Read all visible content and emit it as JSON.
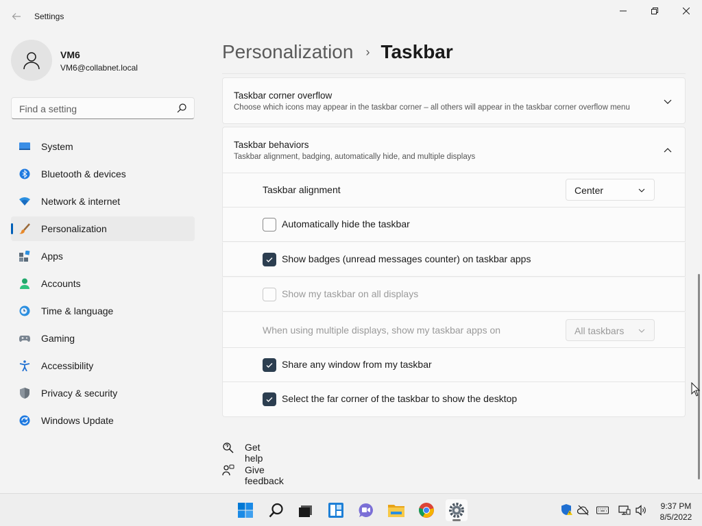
{
  "window": {
    "title": "Settings",
    "back_icon": "back-arrow-icon",
    "controls": [
      "minimize-icon",
      "maximize-icon",
      "close-icon"
    ]
  },
  "profile": {
    "name": "VM6",
    "email": "VM6@collabnet.local"
  },
  "search": {
    "placeholder": "Find a setting"
  },
  "sidebar": {
    "items": [
      {
        "label": "System",
        "icon": "system-icon",
        "selected": false
      },
      {
        "label": "Bluetooth & devices",
        "icon": "bluetooth-icon",
        "selected": false
      },
      {
        "label": "Network & internet",
        "icon": "network-icon",
        "selected": false
      },
      {
        "label": "Personalization",
        "icon": "personalization-brush-icon",
        "selected": true
      },
      {
        "label": "Apps",
        "icon": "apps-icon",
        "selected": false
      },
      {
        "label": "Accounts",
        "icon": "accounts-icon",
        "selected": false
      },
      {
        "label": "Time & language",
        "icon": "time-language-icon",
        "selected": false
      },
      {
        "label": "Gaming",
        "icon": "gaming-icon",
        "selected": false
      },
      {
        "label": "Accessibility",
        "icon": "accessibility-icon",
        "selected": false
      },
      {
        "label": "Privacy & security",
        "icon": "privacy-shield-icon",
        "selected": false
      },
      {
        "label": "Windows Update",
        "icon": "windows-update-icon",
        "selected": false
      }
    ]
  },
  "breadcrumb": {
    "parent": "Personalization",
    "separator": "›",
    "current": "Taskbar"
  },
  "main": {
    "corner_overflow": {
      "title": "Taskbar corner overflow",
      "description": "Choose which icons may appear in the taskbar corner – all others will appear in the taskbar corner overflow menu",
      "expanded": false
    },
    "behaviors": {
      "title": "Taskbar behaviors",
      "description": "Taskbar alignment, badging, automatically hide, and multiple displays",
      "expanded": true,
      "alignment": {
        "label": "Taskbar alignment",
        "value": "Center"
      },
      "options": [
        {
          "label": "Automatically hide the taskbar",
          "checked": false,
          "disabled": false
        },
        {
          "label": "Show badges (unread messages counter) on taskbar apps",
          "checked": true,
          "disabled": false
        },
        {
          "label": "Show my taskbar on all displays",
          "checked": false,
          "disabled": true
        }
      ],
      "multi_display": {
        "label": "When using multiple displays, show my taskbar apps on",
        "value": "All taskbars",
        "disabled": true
      },
      "more_options": [
        {
          "label": "Share any window from my taskbar",
          "checked": true,
          "disabled": false
        },
        {
          "label": "Select the far corner of the taskbar to show the desktop",
          "checked": true,
          "disabled": false
        }
      ]
    },
    "help": {
      "get_help": "Get help",
      "give_feedback": "Give feedback"
    }
  },
  "taskbar": {
    "apps": [
      "start-icon",
      "search-icon",
      "task-view-icon",
      "widgets-icon",
      "chat-icon",
      "file-explorer-icon",
      "chrome-icon",
      "settings-icon"
    ],
    "active_app": "settings-icon",
    "tray": [
      "defender-warning-icon",
      "onedrive-offline-icon",
      "keyboard-icon",
      "display-icon",
      "volume-icon"
    ],
    "time": "9:37 PM",
    "date": "8/5/2022"
  },
  "colors": {
    "accent": "#005fb8",
    "checkbox_checked": "#2c3e50",
    "background": "#f3f3f3",
    "card": "#fbfbfb"
  }
}
